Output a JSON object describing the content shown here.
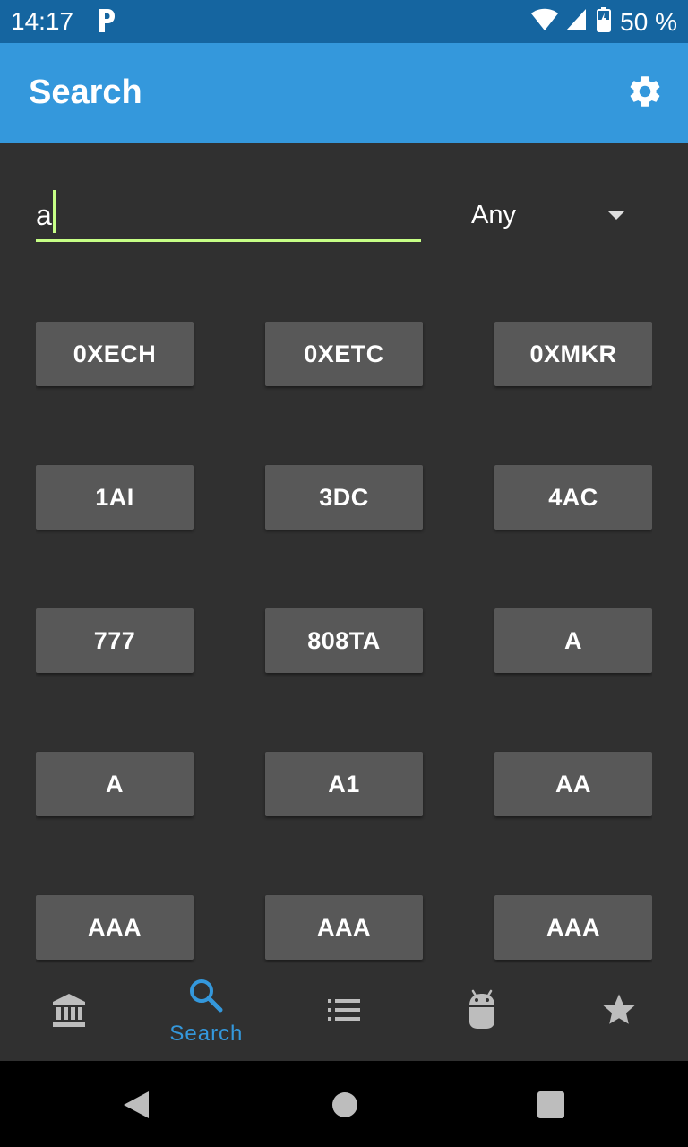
{
  "status_bar": {
    "time": "14:17",
    "battery_percent": "50 %",
    "notification_icon": "parking-p-icon"
  },
  "app_bar": {
    "title": "Search",
    "settings_icon": "gear-icon",
    "background": "#3498dc"
  },
  "search": {
    "value": "a",
    "accent": "#c6ff86"
  },
  "type_filter": {
    "selected": "Any"
  },
  "results": [
    "0XECH",
    "0XETC",
    "0XMKR",
    "1AI",
    "3DC",
    "4AC",
    "777",
    "808TA",
    "A",
    "A",
    "A1",
    "AA",
    "AAA",
    "AAA",
    "AAA"
  ],
  "bottom_nav": {
    "active_index": 1,
    "active_color": "#3498dc",
    "items": [
      {
        "icon": "bank-icon",
        "label": ""
      },
      {
        "icon": "search-icon",
        "label": "Search"
      },
      {
        "icon": "list-icon",
        "label": ""
      },
      {
        "icon": "android-icon",
        "label": ""
      },
      {
        "icon": "star-icon",
        "label": ""
      }
    ]
  }
}
